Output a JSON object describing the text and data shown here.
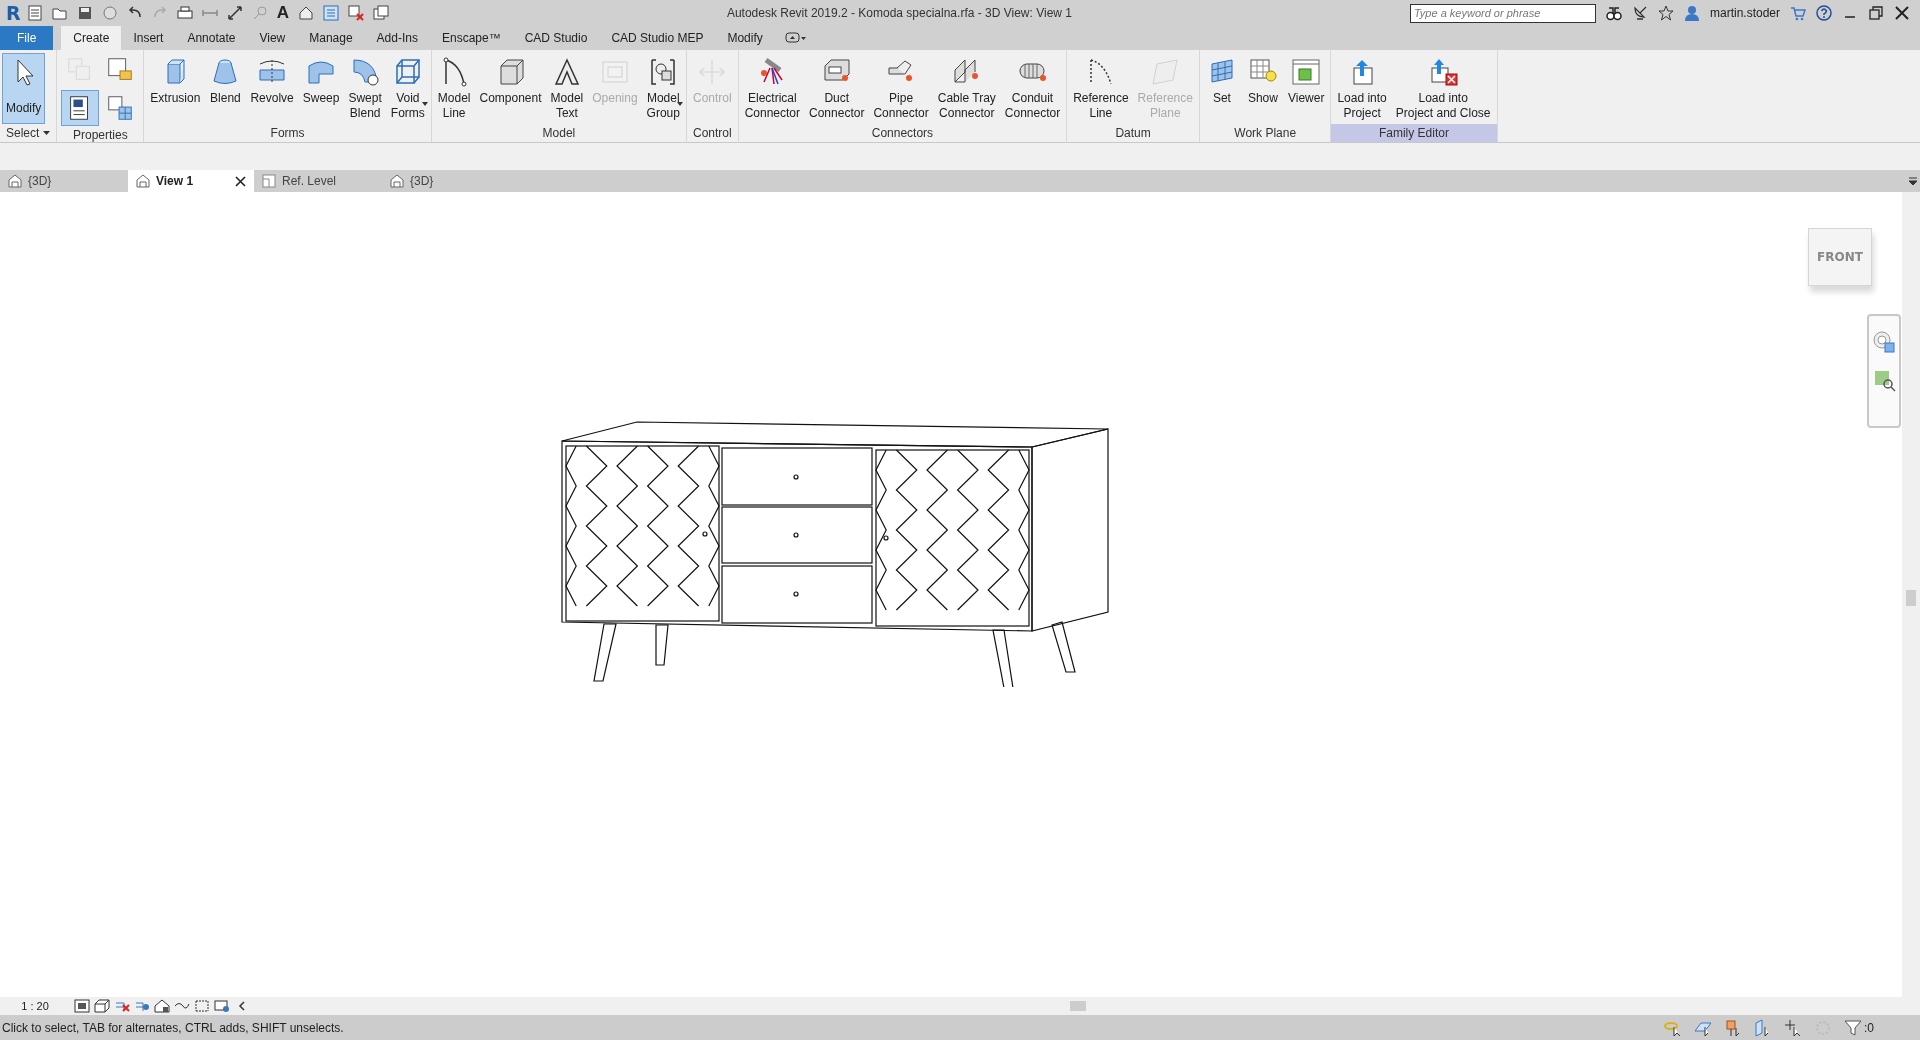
{
  "title_bar": {
    "logo": "R",
    "quick_access_glyph": "A",
    "title": "Autodesk Revit 2019.2 - Komoda specialna.rfa - 3D View: View 1",
    "search": {
      "placeholder": "Type a keyword or phrase"
    },
    "user": "martin.stoder"
  },
  "ribbon_tabs": [
    {
      "label": "File",
      "kind": "file",
      "selected": false
    },
    {
      "label": "Create",
      "kind": "tab",
      "selected": true
    },
    {
      "label": "Insert",
      "kind": "tab",
      "selected": false
    },
    {
      "label": "Annotate",
      "kind": "tab",
      "selected": false
    },
    {
      "label": "View",
      "kind": "tab",
      "selected": false
    },
    {
      "label": "Manage",
      "kind": "tab",
      "selected": false
    },
    {
      "label": "Add-Ins",
      "kind": "tab",
      "selected": false
    },
    {
      "label": "Enscape™",
      "kind": "tab",
      "selected": false
    },
    {
      "label": "CAD Studio",
      "kind": "tab",
      "selected": false
    },
    {
      "label": "CAD Studio MEP",
      "kind": "tab",
      "selected": false
    },
    {
      "label": "Modify",
      "kind": "tab",
      "selected": false
    }
  ],
  "ribbon": {
    "panels": [
      {
        "label": "Select",
        "dropdown": true,
        "highlighted": false,
        "tools": [
          {
            "label": "Modify",
            "kind": "large",
            "selected": true,
            "disabled": false,
            "dropdown": false
          }
        ]
      },
      {
        "label": "Properties",
        "dropdown": false,
        "highlighted": false,
        "tools": [
          {
            "kind": "small",
            "selected": false,
            "disabled": true
          },
          {
            "kind": "small",
            "selected": false,
            "disabled": false
          },
          {
            "kind": "small",
            "selected": true,
            "disabled": false
          },
          {
            "kind": "small",
            "selected": false,
            "disabled": false
          }
        ]
      },
      {
        "label": "Forms",
        "dropdown": false,
        "highlighted": false,
        "tools": [
          {
            "label": "Extrusion",
            "kind": "large",
            "selected": false,
            "disabled": false,
            "dropdown": false
          },
          {
            "label": "Blend",
            "kind": "large",
            "selected": false,
            "disabled": false,
            "dropdown": false
          },
          {
            "label": "Revolve",
            "kind": "large",
            "selected": false,
            "disabled": false,
            "dropdown": false
          },
          {
            "label": "Sweep",
            "kind": "large",
            "selected": false,
            "disabled": false,
            "dropdown": false
          },
          {
            "label": "Swept\nBlend",
            "kind": "large",
            "selected": false,
            "disabled": false,
            "dropdown": false
          },
          {
            "label": "Void\nForms",
            "kind": "large",
            "selected": false,
            "disabled": false,
            "dropdown": true
          }
        ]
      },
      {
        "label": "Model",
        "dropdown": false,
        "highlighted": false,
        "tools": [
          {
            "label": "Model\nLine",
            "kind": "large",
            "selected": false,
            "disabled": false,
            "dropdown": false
          },
          {
            "label": "Component",
            "kind": "large",
            "selected": false,
            "disabled": false,
            "dropdown": false
          },
          {
            "label": "Model\nText",
            "kind": "large",
            "selected": false,
            "disabled": false,
            "dropdown": false
          },
          {
            "label": "Opening",
            "kind": "large",
            "selected": false,
            "disabled": true,
            "dropdown": false
          },
          {
            "label": "Model\nGroup",
            "kind": "large",
            "selected": false,
            "disabled": false,
            "dropdown": true
          }
        ]
      },
      {
        "label": "Control",
        "dropdown": false,
        "highlighted": false,
        "tools": [
          {
            "label": "Control",
            "kind": "large",
            "selected": false,
            "disabled": true,
            "dropdown": false
          }
        ]
      },
      {
        "label": "Connectors",
        "dropdown": false,
        "highlighted": false,
        "tools": [
          {
            "label": "Electrical\nConnector",
            "kind": "large",
            "selected": false,
            "disabled": false,
            "dropdown": false
          },
          {
            "label": "Duct\nConnector",
            "kind": "large",
            "selected": false,
            "disabled": false,
            "dropdown": false
          },
          {
            "label": "Pipe\nConnector",
            "kind": "large",
            "selected": false,
            "disabled": false,
            "dropdown": false
          },
          {
            "label": "Cable Tray\nConnector",
            "kind": "large",
            "selected": false,
            "disabled": false,
            "dropdown": false
          },
          {
            "label": "Conduit\nConnector",
            "kind": "large",
            "selected": false,
            "disabled": false,
            "dropdown": false
          }
        ]
      },
      {
        "label": "Datum",
        "dropdown": false,
        "highlighted": false,
        "tools": [
          {
            "label": "Reference\nLine",
            "kind": "large",
            "selected": false,
            "disabled": false,
            "dropdown": false
          },
          {
            "label": "Reference\nPlane",
            "kind": "large",
            "selected": false,
            "disabled": true,
            "dropdown": false
          }
        ]
      },
      {
        "label": "Work Plane",
        "dropdown": false,
        "highlighted": false,
        "tools": [
          {
            "label": "Set",
            "kind": "large",
            "selected": false,
            "disabled": false,
            "dropdown": false
          },
          {
            "label": "Show",
            "kind": "large",
            "selected": false,
            "disabled": false,
            "dropdown": false
          },
          {
            "label": "Viewer",
            "kind": "large",
            "selected": false,
            "disabled": false,
            "dropdown": false
          }
        ]
      },
      {
        "label": "Family Editor",
        "dropdown": false,
        "highlighted": true,
        "tools": [
          {
            "label": "Load into\nProject",
            "kind": "large",
            "selected": false,
            "disabled": false,
            "dropdown": false
          },
          {
            "label": "Load into\nProject and Close",
            "kind": "large",
            "selected": false,
            "disabled": false,
            "dropdown": false
          }
        ]
      }
    ]
  },
  "view_tabs": [
    {
      "label": "{3D}",
      "kind": "perspective",
      "selected": false
    },
    {
      "label": "View 1",
      "kind": "perspective",
      "selected": true
    },
    {
      "label": "Ref. Level",
      "kind": "plan",
      "selected": false
    },
    {
      "label": "{3D}",
      "kind": "perspective",
      "selected": false
    }
  ],
  "view_cube": {
    "face": "FRONT"
  },
  "view_control_bar": {
    "scale": "1 : 20"
  },
  "status_bar": {
    "message": "Click to select, TAB for alternates, CTRL adds, SHIFT unselects.",
    "filter_count": ":0"
  }
}
